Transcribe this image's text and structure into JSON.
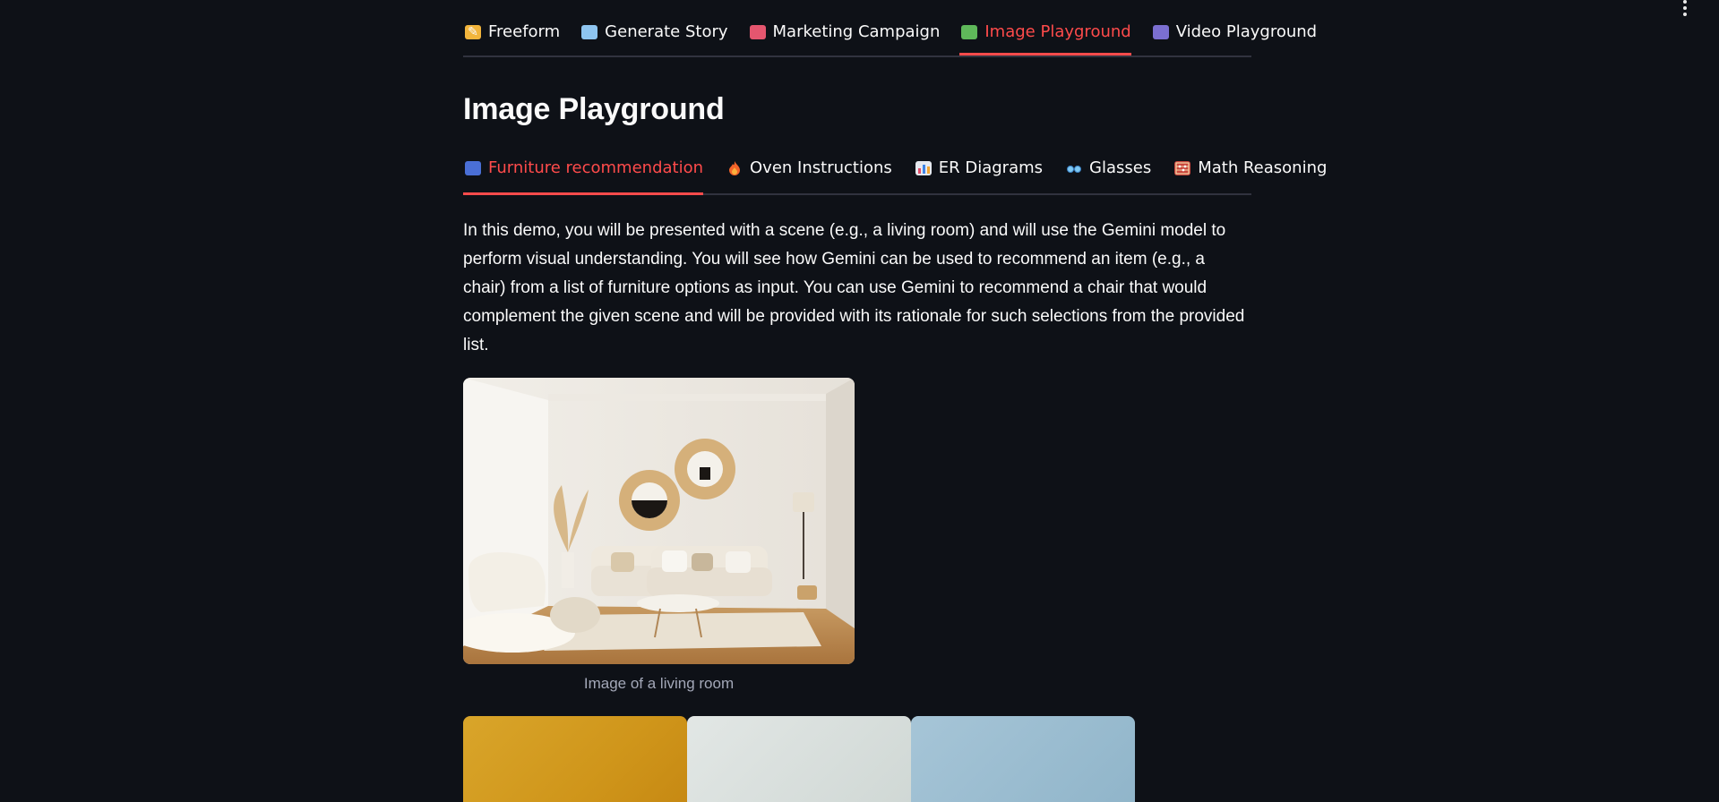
{
  "top_tabs": [
    {
      "label": "Freeform",
      "icon": "memo-icon",
      "active": false
    },
    {
      "label": "Generate Story",
      "icon": "picture-icon",
      "active": false
    },
    {
      "label": "Marketing Campaign",
      "icon": "megaphone-icon",
      "active": false
    },
    {
      "label": "Image Playground",
      "icon": "image-icon",
      "active": true
    },
    {
      "label": "Video Playground",
      "icon": "video-icon",
      "active": false
    }
  ],
  "page_title": "Image Playground",
  "sub_tabs": [
    {
      "label": "Furniture recommendation",
      "icon": "couch-icon",
      "active": true
    },
    {
      "label": "Oven Instructions",
      "icon": "fire-icon",
      "active": false
    },
    {
      "label": "ER Diagrams",
      "icon": "bar-chart-icon",
      "active": false
    },
    {
      "label": "Glasses",
      "icon": "glasses-icon",
      "active": false
    },
    {
      "label": "Math Reasoning",
      "icon": "abacus-icon",
      "active": false
    }
  ],
  "description": "In this demo, you will be presented with a scene (e.g., a living room) and will use the Gemini model to perform visual understanding. You will see how Gemini can be used to recommend an item (e.g., a chair) from a list of furniture options as input. You can use Gemini to recommend a chair that would complement the given scene and will be provided with its rationale for such selections from the provided list.",
  "image_caption": "Image of a living room",
  "colors": {
    "background": "#0e1117",
    "accent": "#ff4b4b",
    "text": "#fafafa",
    "caption": "#a3a8b8",
    "divider": "#31333f"
  }
}
